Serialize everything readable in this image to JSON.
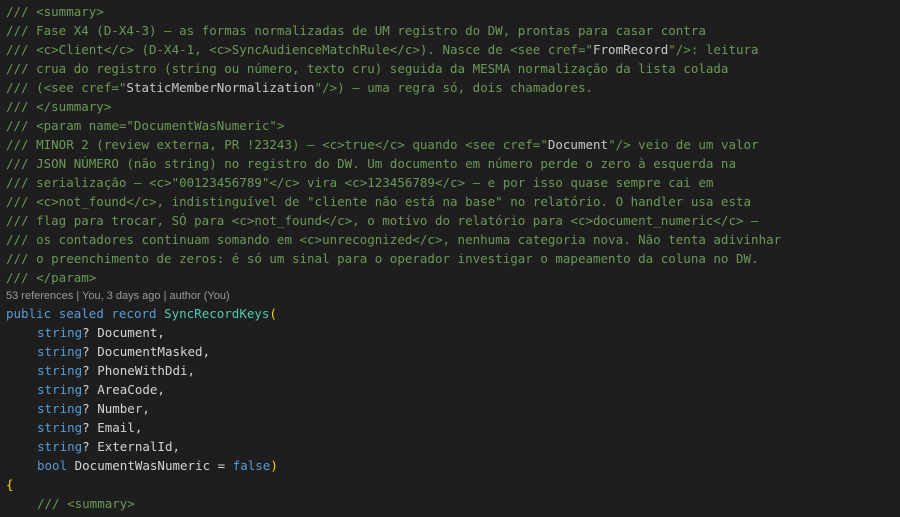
{
  "doc_comment": {
    "summary_open": "/// <summary>",
    "line1": "/// Fase X4 (D-X4-3) — as formas normalizadas de UM registro do DW, prontas para casar contra",
    "line2_a": "/// <c>Client</c> (D-X4-1, <c>SyncAudienceMatchRule</c>). Nasce de <see cref=\"",
    "line2_cref": "FromRecord",
    "line2_b": "\"/>: leitura",
    "line3": "/// crua do registro (string ou número, texto cru) seguida da MESMA normalização da lista colada",
    "line4_a": "/// (<see cref=\"",
    "line4_cref": "StaticMemberNormalization",
    "line4_b": "\"/>) — uma regra só, dois chamadores.",
    "summary_close": "/// </summary>",
    "param_open": "/// <param name=\"DocumentWasNumeric\">",
    "line5_a": "/// MINOR 2 (review externa, PR !23243) — <c>true</c> quando <see cref=\"",
    "line5_cref": "Document",
    "line5_b": "\"/> veio de um valor",
    "line6": "/// JSON NÚMERO (não string) no registro do DW. Um documento em número perde o zero à esquerda na",
    "line7": "/// serialização — <c>\"00123456789\"</c> vira <c>123456789</c> — e por isso quase sempre cai em",
    "line8": "/// <c>not_found</c>, indistinguível de \"cliente não está na base\" no relatório. O handler usa esta",
    "line9": "/// flag para trocar, SÓ para <c>not_found</c>, o motivo do relatório para <c>document_numeric</c> —",
    "line10": "/// os contadores continuam somando em <c>unrecognized</c>, nenhuma categoria nova. Não tenta adivinhar",
    "line11": "/// o preenchimento de zeros: é só um sinal para o operador investigar o mapeamento da coluna no DW.",
    "param_close": "/// </param>"
  },
  "codelens": "53 references | You, 3 days ago | author (You)",
  "declaration": {
    "kw_public": "public",
    "kw_sealed": "sealed",
    "kw_record": "record",
    "type_name": "SyncRecordKeys",
    "open_paren": "("
  },
  "params": [
    {
      "type": "string",
      "rest": "? Document,"
    },
    {
      "type": "string",
      "rest": "? DocumentMasked,"
    },
    {
      "type": "string",
      "rest": "? PhoneWithDdi,"
    },
    {
      "type": "string",
      "rest": "? AreaCode,"
    },
    {
      "type": "string",
      "rest": "? Number,"
    },
    {
      "type": "string",
      "rest": "? Email,"
    },
    {
      "type": "string",
      "rest": "? ExternalId,"
    }
  ],
  "last_param": {
    "kw_bool": "bool",
    "name_eq": " DocumentWasNumeric = ",
    "kw_false": "false",
    "close_paren": ")"
  },
  "open_brace": "{",
  "inner_summary": "/// <summary>",
  "partial_line": "/// ..."
}
